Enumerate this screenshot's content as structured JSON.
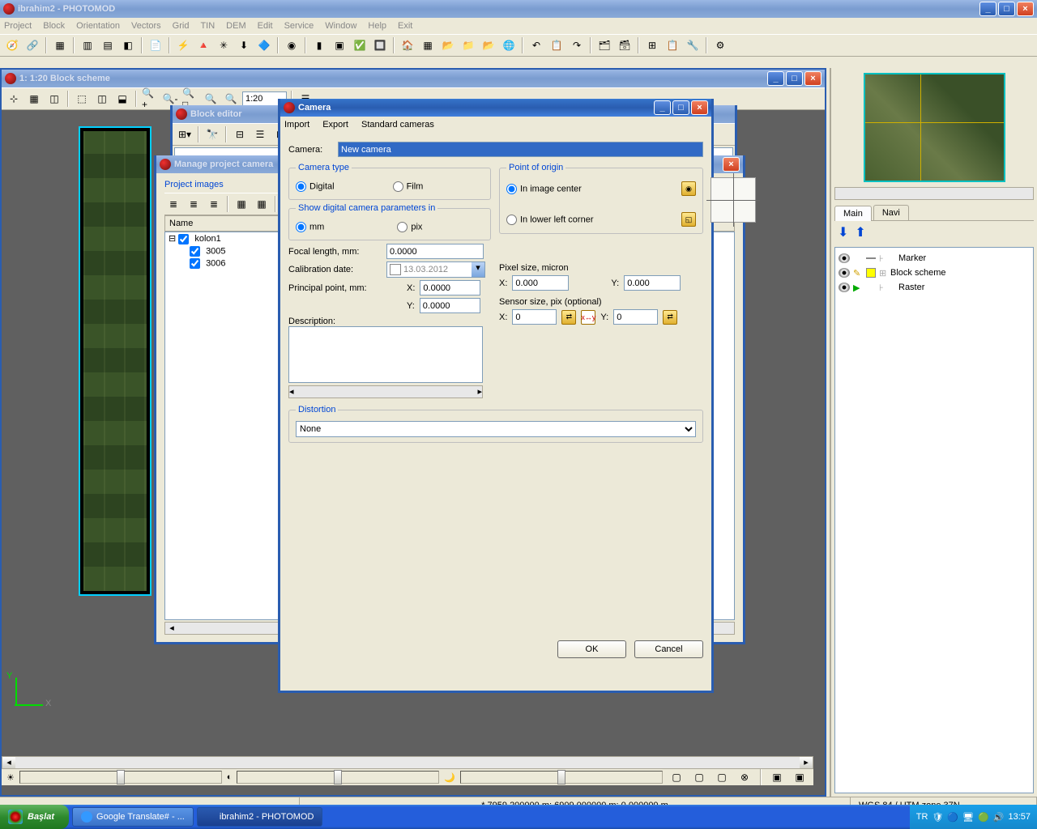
{
  "main_window": {
    "title": "ibrahim2 - PHOTOMOD",
    "menu": [
      "Project",
      "Block",
      "Orientation",
      "Vectors",
      "Grid",
      "TIN",
      "DEM",
      "Edit",
      "Service",
      "Window",
      "Help",
      "Exit"
    ]
  },
  "block_scheme": {
    "title": "1: 1:20 Block scheme",
    "scale_input": "1:20"
  },
  "block_editor": {
    "title": "Block editor"
  },
  "manage_cameras": {
    "title": "Manage project camera",
    "panel_label": "Project images",
    "name_header": "Name",
    "tree": {
      "root": "kolon1",
      "children": [
        "3005",
        "3006"
      ],
      "selected": "3005"
    }
  },
  "camera_dialog": {
    "title": "Camera",
    "menu": [
      "Import",
      "Export",
      "Standard cameras"
    ],
    "camera_label": "Camera:",
    "camera_value": "New camera",
    "camera_type": {
      "legend": "Camera type",
      "digital": "Digital",
      "film": "Film",
      "selected": "digital"
    },
    "show_params": {
      "legend": "Show digital camera parameters in",
      "mm": "mm",
      "pix": "pix",
      "selected": "mm"
    },
    "focal_label": "Focal length, mm:",
    "focal_value": "0.0000",
    "calib_label": "Calibration date:",
    "calib_value": "13.03.2012",
    "pp_label": "Principal point, mm:",
    "pp_x_label": "X:",
    "pp_x": "0.0000",
    "pp_y_label": "Y:",
    "pp_y": "0.0000",
    "desc_label": "Description:",
    "origin": {
      "legend": "Point of origin",
      "center": "In image center",
      "lower_left": "In lower left corner",
      "selected": "center"
    },
    "pixel_size": {
      "label": "Pixel size, micron",
      "x_label": "X:",
      "x": "0.000",
      "y_label": "Y:",
      "y": "0.000"
    },
    "sensor_size": {
      "label": "Sensor size, pix (optional)",
      "x_label": "X:",
      "x": "0",
      "y_label": "Y:",
      "y": "0"
    },
    "distortion": {
      "legend": "Distortion",
      "value": "None"
    },
    "ok": "OK",
    "cancel": "Cancel"
  },
  "right_panel": {
    "tabs": {
      "main": "Main",
      "navi": "Navi"
    },
    "layers": {
      "marker": "Marker",
      "block_scheme": "Block scheme",
      "raster": "Raster"
    }
  },
  "status": {
    "coords": "* 7959.200000 m; 6909.000000 m; 0.000000 m",
    "crs": "WGS 84 / UTM zone 37N"
  },
  "taskbar": {
    "start": "Başlat",
    "tasks": [
      "Google Translate# - ...",
      "ibrahim2 - PHOTOMOD"
    ],
    "lang": "TR",
    "clock": "13:57"
  },
  "axes": {
    "x": "X",
    "y": "Y"
  }
}
